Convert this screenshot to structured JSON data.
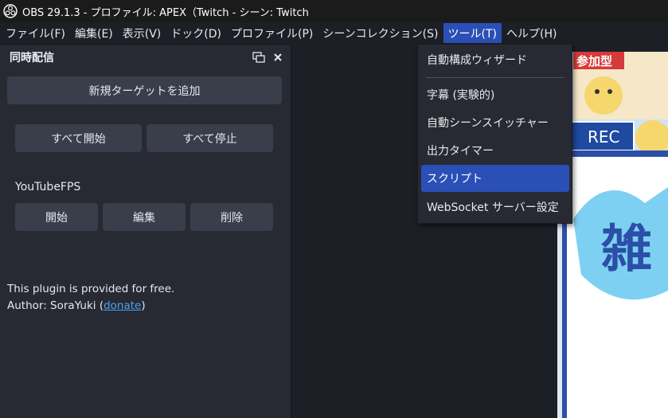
{
  "window": {
    "title": "OBS 29.1.3 - プロファイル: APEX（Twitch - シーン: Twitch"
  },
  "menubar": {
    "items": [
      {
        "label": "ファイル(F)"
      },
      {
        "label": "編集(E)"
      },
      {
        "label": "表示(V)"
      },
      {
        "label": "ドック(D)"
      },
      {
        "label": "プロファイル(P)"
      },
      {
        "label": "シーンコレクション(S)"
      },
      {
        "label": "ツール(T)"
      },
      {
        "label": "ヘルプ(H)"
      }
    ]
  },
  "dock": {
    "title": "同時配信",
    "add_target_button": "新規ターゲットを追加",
    "start_all_button": "すべて開始",
    "stop_all_button": "すべて停止",
    "target_name": "YouTubeFPS",
    "start_button": "開始",
    "edit_button": "編集",
    "delete_button": "削除",
    "info_line1": "This plugin is provided for free.",
    "info_author_prefix": "Author: SoraYuki (",
    "info_author_link": "donate",
    "info_author_suffix": ")"
  },
  "tools_menu": {
    "items": [
      {
        "label": "自動構成ウィザード"
      },
      {
        "label": "字幕 (実験的)"
      },
      {
        "label": "自動シーンスイッチャー"
      },
      {
        "label": "出力タイマー"
      },
      {
        "label": "スクリプト",
        "highlighted": true
      },
      {
        "label": "WebSocket サーバー設定"
      }
    ]
  },
  "preview": {
    "badge_text": "参加型",
    "rec_text": "REC",
    "art_glyph": "雑"
  },
  "colors": {
    "accent": "#2a4fb6",
    "panel": "#272a33",
    "background": "#1d1f26",
    "button": "#3a3e4a",
    "link": "#4aa3f5"
  }
}
